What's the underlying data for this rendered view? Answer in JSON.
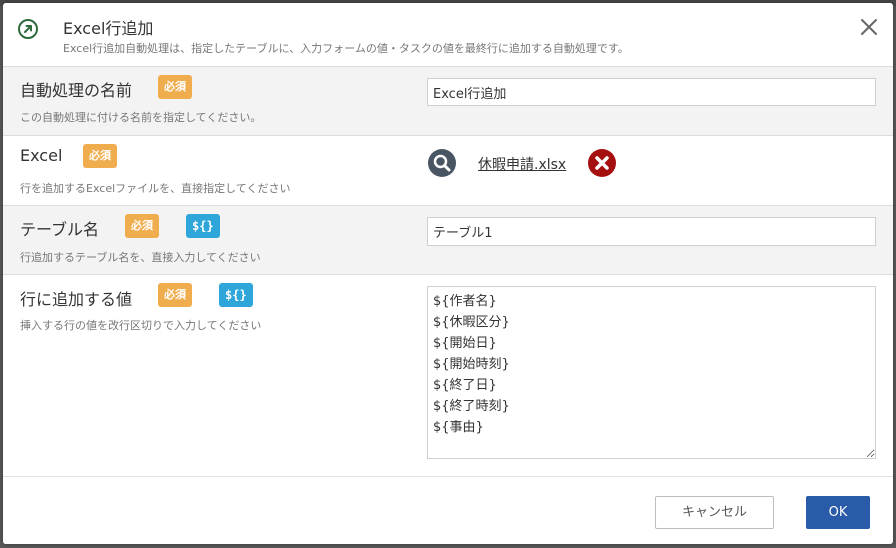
{
  "header": {
    "title": "Excel行追加",
    "description": "Excel行追加自動処理は、指定したテーブルに、入力フォームの値・タスクの値を最終行に追加する自動処理です。"
  },
  "badges": {
    "required": "必須",
    "variable": "${}"
  },
  "fields": {
    "name": {
      "label": "自動処理の名前",
      "help": "この自動処理に付ける名前を指定してください。",
      "value": "Excel行追加"
    },
    "excel": {
      "label": "Excel",
      "help": "行を追加するExcelファイルを、直接指定してください",
      "file_name": "休暇申請.xlsx"
    },
    "table": {
      "label": "テーブル名",
      "help": "行追加するテーブル名を、直接入力してください",
      "value": "テーブル1"
    },
    "values": {
      "label": "行に追加する値",
      "help": "挿入する行の値を改行区切りで入力してください",
      "value": "${作者名}\n${休暇区分}\n${開始日}\n${開始時刻}\n${終了日}\n${終了時刻}\n${事由}"
    }
  },
  "footer": {
    "cancel_label": "キャンセル",
    "ok_label": "OK"
  },
  "icons": {
    "header": "arrow-up-right-circle-icon",
    "close": "close-icon",
    "search": "search-icon",
    "remove": "remove-file-icon"
  },
  "colors": {
    "required_badge": "#f0ad4e",
    "variable_badge": "#2ea6d9",
    "ok_button": "#2a5ba8",
    "remove_icon": "#a50f0f",
    "search_icon": "#4a5563",
    "header_icon": "#2e6b3c"
  }
}
